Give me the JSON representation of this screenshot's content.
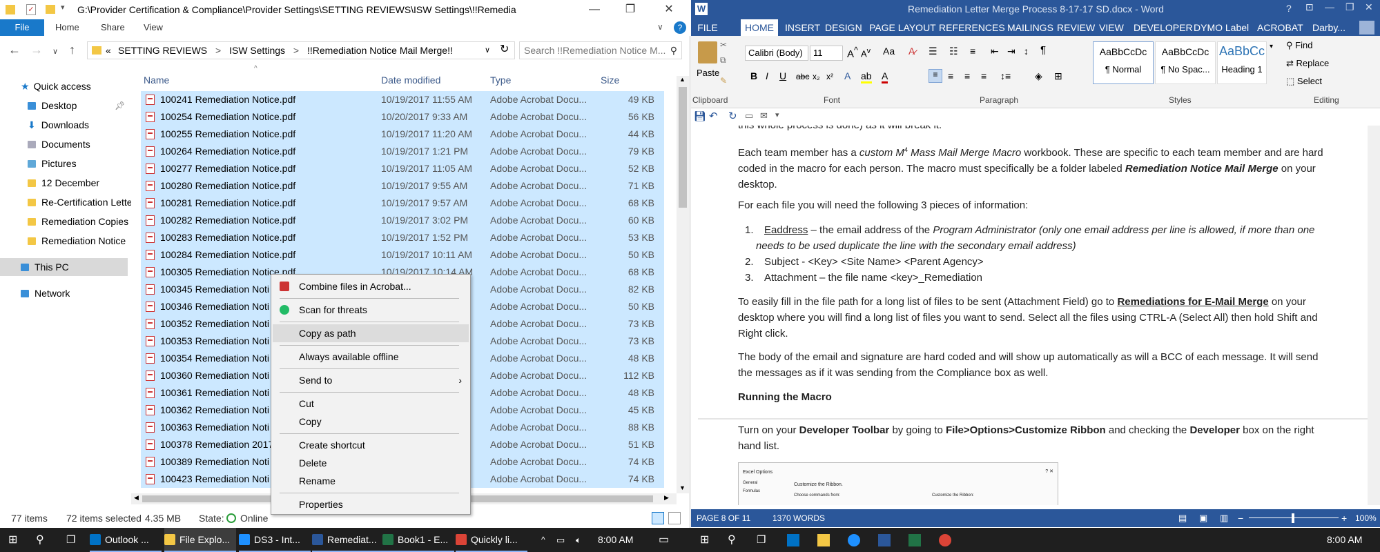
{
  "explorer": {
    "title_path": "G:\\Provider Certification & Compliance\\Provider Settings\\SETTING REVIEWS\\ISW Settings\\!!Remedia",
    "tabs": {
      "file": "File",
      "home": "Home",
      "share": "Share",
      "view": "View"
    },
    "breadcrumb": [
      "«",
      "SETTING REVIEWS",
      ">",
      "ISW Settings",
      ">",
      "!!Remediation Notice Mail Merge!!"
    ],
    "search_placeholder": "Search !!Remediation Notice M...",
    "columns": {
      "name": "Name",
      "date": "Date modified",
      "type": "Type",
      "size": "Size"
    },
    "nav": {
      "quick_access": "Quick access",
      "desktop": "Desktop",
      "downloads": "Downloads",
      "documents": "Documents",
      "pictures": "Pictures",
      "folder1": "12 December",
      "folder2": "Re-Certification Lette",
      "folder3": "Remediation Copies",
      "folder4": "Remediation Notice",
      "this_pc": "This PC",
      "network": "Network"
    },
    "files": [
      {
        "name": "100241 Remediation Notice.pdf",
        "date": "10/19/2017 11:55 AM",
        "type": "Adobe Acrobat Docu...",
        "size": "49 KB"
      },
      {
        "name": "100254 Remediation Notice.pdf",
        "date": "10/20/2017 9:33 AM",
        "type": "Adobe Acrobat Docu...",
        "size": "56 KB"
      },
      {
        "name": "100255 Remediation Notice.pdf",
        "date": "10/19/2017 11:20 AM",
        "type": "Adobe Acrobat Docu...",
        "size": "44 KB"
      },
      {
        "name": "100264 Remediation Notice.pdf",
        "date": "10/19/2017 1:21 PM",
        "type": "Adobe Acrobat Docu...",
        "size": "79 KB"
      },
      {
        "name": "100277 Remediation Notice.pdf",
        "date": "10/19/2017 11:05 AM",
        "type": "Adobe Acrobat Docu...",
        "size": "52 KB"
      },
      {
        "name": "100280 Remediation Notice.pdf",
        "date": "10/19/2017 9:55 AM",
        "type": "Adobe Acrobat Docu...",
        "size": "71 KB"
      },
      {
        "name": "100281 Remediation Notice.pdf",
        "date": "10/19/2017 9:57 AM",
        "type": "Adobe Acrobat Docu...",
        "size": "68 KB"
      },
      {
        "name": "100282 Remediation Notice.pdf",
        "date": "10/19/2017 3:02 PM",
        "type": "Adobe Acrobat Docu...",
        "size": "60 KB"
      },
      {
        "name": "100283 Remediation Notice.pdf",
        "date": "10/19/2017 1:52 PM",
        "type": "Adobe Acrobat Docu...",
        "size": "53 KB"
      },
      {
        "name": "100284 Remediation Notice.pdf",
        "date": "10/19/2017 10:11 AM",
        "type": "Adobe Acrobat Docu...",
        "size": "50 KB"
      },
      {
        "name": "100305 Remediation Notice.pdf",
        "date": "10/19/2017 10:14 AM",
        "type": "Adobe Acrobat Docu...",
        "size": "68 KB"
      },
      {
        "name": "100345 Remediation Noti",
        "date": "",
        "type": "Adobe Acrobat Docu...",
        "size": "82 KB"
      },
      {
        "name": "100346 Remediation Noti",
        "date": "",
        "type": "Adobe Acrobat Docu...",
        "size": "50 KB"
      },
      {
        "name": "100352 Remediation Noti",
        "date": "",
        "type": "Adobe Acrobat Docu...",
        "size": "73 KB"
      },
      {
        "name": "100353 Remediation Noti",
        "date": "",
        "type": "Adobe Acrobat Docu...",
        "size": "73 KB"
      },
      {
        "name": "100354 Remediation Noti",
        "date": "",
        "type": "Adobe Acrobat Docu...",
        "size": "48 KB"
      },
      {
        "name": "100360 Remediation Noti",
        "date": "",
        "type": "Adobe Acrobat Docu...",
        "size": "112 KB"
      },
      {
        "name": "100361 Remediation Noti",
        "date": "",
        "type": "Adobe Acrobat Docu...",
        "size": "48 KB"
      },
      {
        "name": "100362 Remediation Noti",
        "date": "",
        "type": "Adobe Acrobat Docu...",
        "size": "45 KB"
      },
      {
        "name": "100363 Remediation Noti",
        "date": "",
        "type": "Adobe Acrobat Docu...",
        "size": "88 KB"
      },
      {
        "name": "100378 Remediation 2017",
        "date": "",
        "type": "Adobe Acrobat Docu...",
        "size": "51 KB"
      },
      {
        "name": "100389 Remediation Noti",
        "date": "",
        "type": "Adobe Acrobat Docu...",
        "size": "74 KB"
      },
      {
        "name": "100423 Remediation Noti",
        "date": "",
        "type": "Adobe Acrobat Docu...",
        "size": "74 KB"
      }
    ],
    "status": {
      "items": "77 items",
      "selected": "72 items selected",
      "size": "4.35 MB",
      "state_label": "State:",
      "state": "Online"
    }
  },
  "context_menu": {
    "combine": "Combine files in Acrobat...",
    "scan": "Scan for threats",
    "copy_path": "Copy as path",
    "offline": "Always available offline",
    "send_to": "Send to",
    "cut": "Cut",
    "copy": "Copy",
    "shortcut": "Create shortcut",
    "delete": "Delete",
    "rename": "Rename",
    "properties": "Properties"
  },
  "word": {
    "title": "Remediation Letter Merge Process 8-17-17 SD.docx - Word",
    "user": "Darby...",
    "tabs": [
      "FILE",
      "HOME",
      "INSERT",
      "DESIGN",
      "PAGE LAYOUT",
      "REFERENCES",
      "MAILINGS",
      "REVIEW",
      "VIEW",
      "DEVELOPER",
      "DYMO Label",
      "ACROBAT"
    ],
    "ribbon": {
      "paste": "Paste",
      "clipboard": "Clipboard",
      "font_name": "Calibri (Body)",
      "font_size": "11",
      "font": "Font",
      "paragraph": "Paragraph",
      "styles": "Styles",
      "editing": "Editing",
      "style1_sample": "AaBbCcDc",
      "style1": "¶ Normal",
      "style2_sample": "AaBbCcDc",
      "style2": "¶ No Spac...",
      "style3_sample": "AaBbCc",
      "style3": "Heading 1",
      "find": "Find",
      "replace": "Replace",
      "select": "Select"
    },
    "doc": {
      "top": "this whole process is done) as it will break it.",
      "p1a": "Each team member has a",
      "p1b": "custom M",
      "p1c": "4",
      "p1d": "Mass Mail Merge Macro",
      "p1e": "workbook. These are specific to each team member and are hard coded in the macro for each person. The macro must specifically be a folder labeled",
      "p1f": "Remediation Notice Mail Merge",
      "p1g": "on your desktop.",
      "p2": "For each file you will need the following 3 pieces of information:",
      "li1a": "Eaddress",
      "li1b": "– the email address of the",
      "li1c": "Program Administrator",
      "li1d": "(only one email address per line is allowed, if more than one needs to be used duplicate the line with the secondary email address)",
      "li2": "Subject - <Key> <Site Name> <Parent Agency>",
      "li3": "Attachment – the file name <key>_Remediation",
      "p3a": "To easily fill in the file path for a long list of files to be sent (Attachment Field) go to",
      "p3b": "Remediations for E-Mail Merge",
      "p3c": "on your desktop where you will find a long list of files you want to send. Select all the files using CTRL-A (Select All) then hold Shift and Right click.",
      "p4": "The body of the email and signature are hard coded and will show up automatically as will a BCC of each message. It will send the messages as if it was sending from the Compliance box as well.",
      "h1": "Running the Macro",
      "p5a": "Turn on your",
      "p5b": "Developer Toolbar",
      "p5c": "by going to",
      "p5d": "File>Options>Customize Ribbon",
      "p5e": "and checking the",
      "p5f": "Developer",
      "p5g": "box on the right hand list.",
      "thumb_title": "Excel Options",
      "thumb_general": "General",
      "thumb_formulas": "Formulas",
      "thumb_customize": "Customize the Ribbon.",
      "thumb_choose": "Choose commands from:",
      "thumb_customize2": "Customize the Ribbon:"
    },
    "status": {
      "page": "PAGE 8 OF 11",
      "words": "1370 WORDS",
      "zoom": "100%"
    }
  },
  "taskbar": {
    "left": [
      {
        "label": "Outlook ...",
        "color": "#0072c6"
      },
      {
        "label": "File Explo...",
        "color": "#f3c745"
      },
      {
        "label": "DS3 - Int...",
        "color": "#1e90ff"
      },
      {
        "label": "Remediat...",
        "color": "#2b579a"
      },
      {
        "label": "Book1 - E...",
        "color": "#217346"
      },
      {
        "label": "Quickly li...",
        "color": "#db4437"
      }
    ],
    "time_left": "8:00 AM",
    "time_right": "8:00 AM"
  },
  "colors": {
    "selection": "#cce8ff",
    "word_blue": "#2b579a",
    "file_tab": "#1979ca"
  }
}
